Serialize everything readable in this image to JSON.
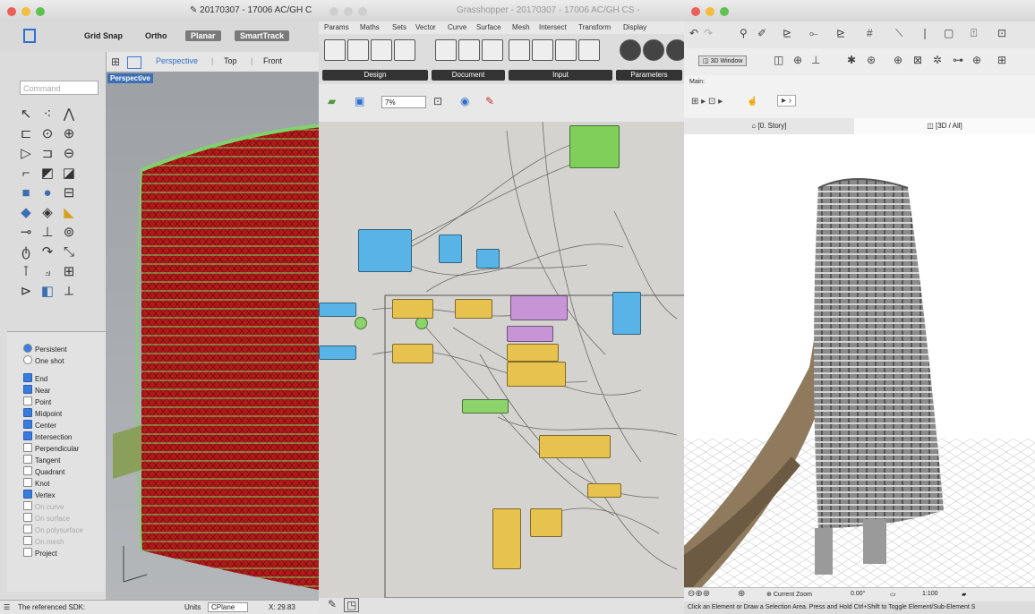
{
  "colors": {
    "close": "#ec5f56",
    "minimize": "#f3be3e",
    "zoom": "#5fc24f",
    "accent": "#3a7be0"
  },
  "rhino": {
    "title": "20170307 - 17006 AC/GH C",
    "toolbar": [
      "Grid Snap",
      "Ortho",
      "Planar",
      "SmartTrack"
    ],
    "viewtabs": [
      "Perspective",
      "Top",
      "Front"
    ],
    "command_placeholder": "Command",
    "viewport_label": "Perspective",
    "osnap_modes": {
      "persistent": "Persistent",
      "one_shot": "One shot"
    },
    "snaps": [
      {
        "label": "End",
        "checked": true
      },
      {
        "label": "Near",
        "checked": true
      },
      {
        "label": "Point",
        "checked": false
      },
      {
        "label": "Midpoint",
        "checked": true
      },
      {
        "label": "Center",
        "checked": true
      },
      {
        "label": "Intersection",
        "checked": true
      },
      {
        "label": "Perpendicular",
        "checked": false
      },
      {
        "label": "Tangent",
        "checked": false
      },
      {
        "label": "Quadrant",
        "checked": false
      },
      {
        "label": "Knot",
        "checked": false
      },
      {
        "label": "Vertex",
        "checked": true
      },
      {
        "label": "On curve",
        "checked": false,
        "disabled": true
      },
      {
        "label": "On surface",
        "checked": false,
        "disabled": true
      },
      {
        "label": "On polysurface",
        "checked": false,
        "disabled": true
      },
      {
        "label": "On mesh",
        "checked": false,
        "disabled": true
      },
      {
        "label": "Project",
        "checked": false
      }
    ],
    "status": {
      "message": "The referenced SDK:",
      "units_label": "Units",
      "cplane": "CPlane",
      "x": "X: 29.83"
    }
  },
  "grasshopper": {
    "title": "Grasshopper - 20170307 - 17006 AC/GH CS - ",
    "menu": [
      "Params",
      "Maths",
      "Sets",
      "Vector",
      "Curve",
      "Surface",
      "Mesh",
      "Intersect",
      "Transform",
      "Display"
    ],
    "ribbon_groups": [
      "Design",
      "Document",
      "Input",
      "Parameters"
    ],
    "zoom": "7%"
  },
  "archicad": {
    "tool_label": "3D Window",
    "main_label": "Main:",
    "tabs": [
      "[0. Story]",
      "[3D / All]"
    ],
    "zoom_label": "Current Zoom",
    "angle": "0.00°",
    "scale": "1:100",
    "hint": "Click an Element or Draw a Selection Area. Press and Hold Ctrl+Shift to Toggle Element/Sub-Element S"
  }
}
